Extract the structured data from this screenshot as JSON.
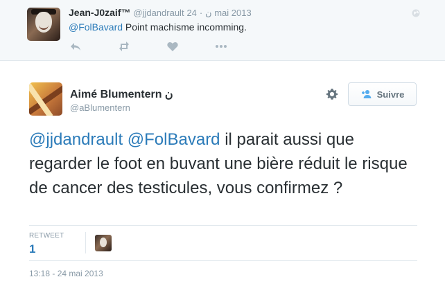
{
  "parent_tweet": {
    "name": "Jean-J0zaif™",
    "handle": "@jjdandrault",
    "badge": "ن",
    "separator": "·",
    "date": "24 mai 2013",
    "mention": "@FolBavard",
    "text": " Point machisme incomming.",
    "icons": [
      "reply-icon",
      "retweet-icon",
      "like-icon",
      "more-icon",
      "globe-icon"
    ]
  },
  "main_tweet": {
    "name": "Aimé Blumentern",
    "badge": "ن",
    "handle": "@aBlumentern",
    "follow_label": "Suivre",
    "mentions": [
      "@jjdandrault",
      "@FolBavard"
    ],
    "text": " il parait aussi que regarder le foot en buvant une bière réduit le risque de cancer des testicules, vous confirmez ?",
    "retweet_label": "RETWEET",
    "retweet_count": "1",
    "timestamp": "13:18 - 24 mai 2013"
  },
  "colors": {
    "link": "#2b7bb9",
    "muted": "#8899a6",
    "text": "#292f33",
    "border": "#e1e8ed",
    "parent_background": "#f5f8fa"
  }
}
